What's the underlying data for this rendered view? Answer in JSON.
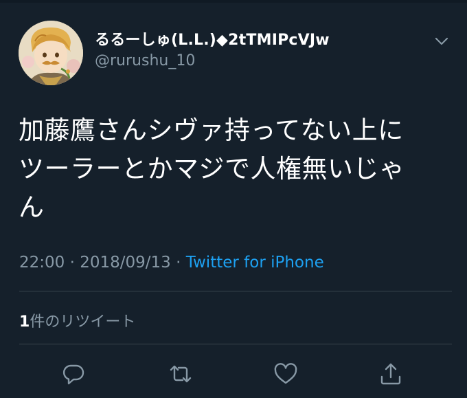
{
  "author": {
    "display_name": "るるーしゅ(L.L.)◆2tTMIPcVJw",
    "handle": "@rurushu_10",
    "avatar_icon": "illustrated-avatar-icon"
  },
  "tweet": {
    "lines": [
      "加藤鷹さんシヴァ持ってない上に",
      "ツーラーとかマジで人権無いじゃ",
      "ん"
    ],
    "time": "22:00",
    "separator": "·",
    "date": "2018/09/13",
    "source": "Twitter for iPhone"
  },
  "stats": {
    "retweet_count": "1",
    "retweet_label": "件のリツイート"
  },
  "actions": [
    {
      "name": "reply",
      "icon": "reply-icon"
    },
    {
      "name": "retweet",
      "icon": "retweet-icon"
    },
    {
      "name": "like",
      "icon": "heart-icon"
    },
    {
      "name": "share",
      "icon": "share-icon"
    }
  ],
  "colors": {
    "background": "#15202b",
    "text": "#ffffff",
    "secondary_text": "#8899a6",
    "link": "#1da1f2",
    "divider": "#38444d"
  }
}
